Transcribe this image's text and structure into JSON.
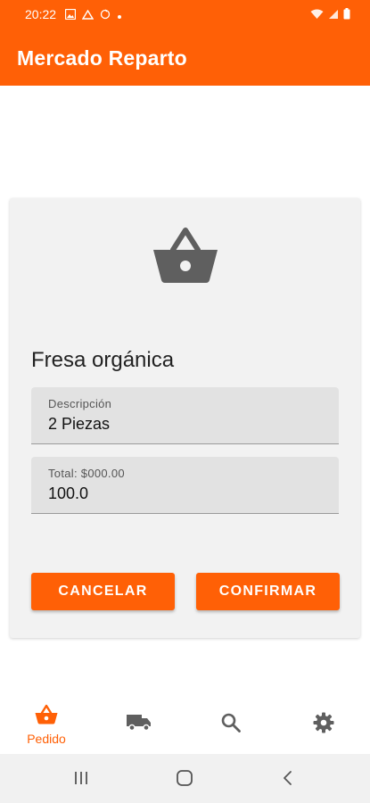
{
  "status_bar": {
    "time": "20:22",
    "icons": [
      "image-icon",
      "cloud-icon",
      "sync-icon",
      "dot-icon",
      "wifi-icon",
      "signal-icon",
      "battery-icon"
    ]
  },
  "app_bar": {
    "title": "Mercado Reparto"
  },
  "card": {
    "icon": "basket-icon",
    "product_name": "Fresa orgánica",
    "description": {
      "label": "Descripción",
      "value": "2 Piezas"
    },
    "total": {
      "label": "Total: $000.00",
      "value": "100.0"
    },
    "cancel_label": "CANCELAR",
    "confirm_label": "CONFIRMAR"
  },
  "bottom_nav": {
    "items": [
      {
        "icon": "basket-icon",
        "label": "Pedido",
        "active": true
      },
      {
        "icon": "truck-icon",
        "label": "",
        "active": false
      },
      {
        "icon": "search-icon",
        "label": "",
        "active": false
      },
      {
        "icon": "gear-icon",
        "label": "",
        "active": false
      }
    ]
  },
  "system_nav": {
    "buttons": [
      "recents-icon",
      "home-icon",
      "back-icon"
    ]
  },
  "colors": {
    "accent": "#ff6006",
    "icon_gray": "#5f5f5f",
    "card_bg": "#f2f2f2",
    "field_bg": "#e2e2e2"
  }
}
